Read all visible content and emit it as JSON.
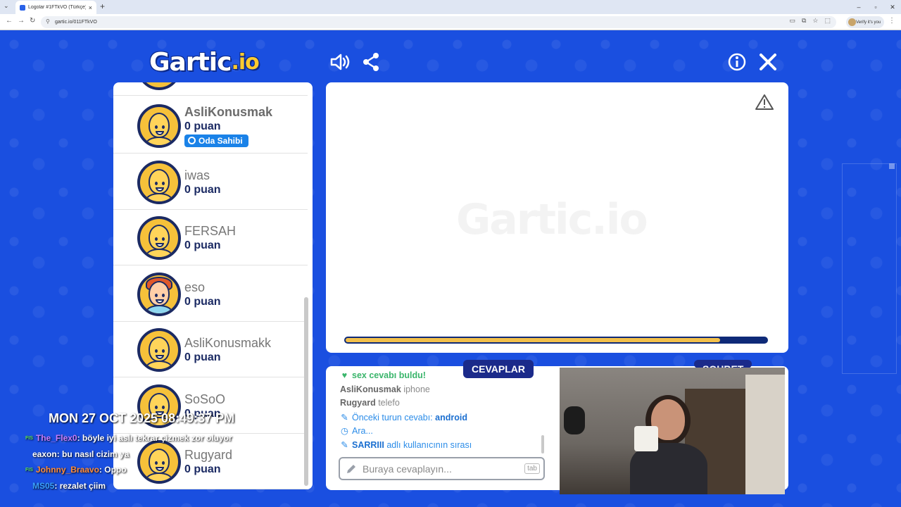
{
  "browser": {
    "tab_title": "Logolar #1FTkVO (Türkçe) - Ga",
    "url": "gartic.io/011FTkVO",
    "verify_label": "Verify it's you"
  },
  "game": {
    "logo_main": "Gartic",
    "logo_suffix": ".io",
    "canvas_watermark": "Gartic.io",
    "progress_fraction": 0.89
  },
  "players": [
    {
      "name": "AsliKonusmak",
      "score": "0 puan",
      "badge": "Oda Sahibi",
      "avatar": "yellow",
      "bold": true
    },
    {
      "name": "iwas",
      "score": "0 puan",
      "avatar": "yellow",
      "bold": false
    },
    {
      "name": "FERSAH",
      "score": "0 puan",
      "avatar": "yellow",
      "bold": false
    },
    {
      "name": "eso",
      "score": "0 puan",
      "avatar": "red",
      "bold": false
    },
    {
      "name": "AsliKonusmakk",
      "score": "0 puan",
      "avatar": "yellow",
      "bold": false
    },
    {
      "name": "SoSoO",
      "score": "0 puan",
      "avatar": "yellow",
      "bold": false
    },
    {
      "name": "Rugyard",
      "score": "0 puan",
      "avatar": "yellow",
      "bold": false
    }
  ],
  "chat": {
    "tab_answers": "CEVAPLAR",
    "tab_chat": "SOHBET",
    "messages": [
      {
        "type": "green",
        "icon": "heart-icon",
        "text": "sex cevabı buldu!"
      },
      {
        "type": "user",
        "user": "AsliKonusmak",
        "text": "iphone"
      },
      {
        "type": "user",
        "user": "Rugyard",
        "text": "telefo"
      },
      {
        "type": "sys",
        "icon": "pencil-icon",
        "text": "Önceki turun cevabı: ",
        "bold": "android"
      },
      {
        "type": "sys",
        "icon": "clock-icon",
        "text": "Ara..."
      },
      {
        "type": "sys",
        "icon": "pencil-icon",
        "bold": "SARRIII",
        "text": " adlı kullanıcının sırası"
      }
    ],
    "input_placeholder": "Buraya cevaplayın...",
    "tab_key_hint": "tab"
  },
  "overlay": {
    "datetime": "MON 27 OCT 2025 08:49:37 PM",
    "chat": [
      {
        "nick": "The_Flex0",
        "nick_color": "#c77dff",
        "badge": "FIS",
        "text": ": böyle iyi aslı tekrar çizmek zor oluyor"
      },
      {
        "nick": "eaxon",
        "nick_color": "#ffffff",
        "badge": "",
        "text": ": bu nasıl cizim ya"
      },
      {
        "nick": "Johnny_Braavo",
        "nick_color": "#ff8c3a",
        "badge": "FIS",
        "text": ": Oppo"
      },
      {
        "nick": "MS05",
        "nick_color": "#3aa0ff",
        "badge": "",
        "text": ": rezalet çiim"
      }
    ]
  },
  "colors": {
    "background": "#1a4fe0",
    "navy": "#1b2a63",
    "progress_fill": "#f2c04c",
    "badge_blue": "#1a82e8"
  }
}
